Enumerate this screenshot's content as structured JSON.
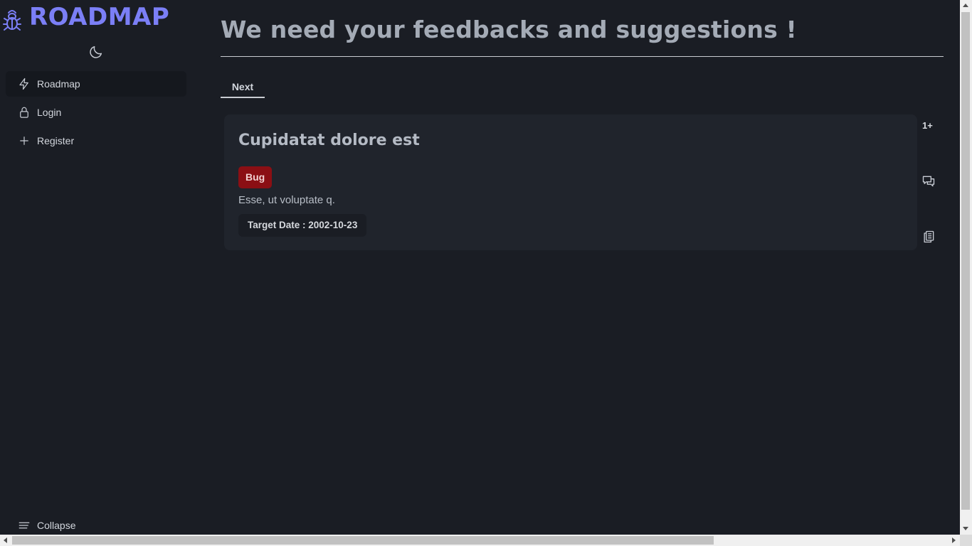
{
  "brand": {
    "name": "ROADMAP",
    "logo_icon": "bug-icon",
    "accent_color": "#7b7ff6"
  },
  "theme_toggle": {
    "icon": "moon-icon"
  },
  "sidebar": {
    "items": [
      {
        "label": "Roadmap",
        "icon": "lightning-icon",
        "active": true
      },
      {
        "label": "Login",
        "icon": "lock-icon",
        "active": false
      },
      {
        "label": "Register",
        "icon": "plus-icon",
        "active": false
      }
    ],
    "collapse_label": "Collapse",
    "collapse_icon": "menu-lines-icon"
  },
  "main": {
    "title": "We need your feedbacks and suggestions !",
    "tabs": [
      {
        "label": "Next",
        "active": true
      }
    ]
  },
  "feature_card": {
    "title": "Cupidatat dolore est",
    "tag": {
      "label": "Bug",
      "color": "#8b0f14"
    },
    "description": "Esse, ut voluptate q.",
    "target_date": "Target Date : 2002-10-23",
    "votes": "1+",
    "comment_icon": "comments-icon",
    "copy_icon": "clipboard-icon"
  }
}
